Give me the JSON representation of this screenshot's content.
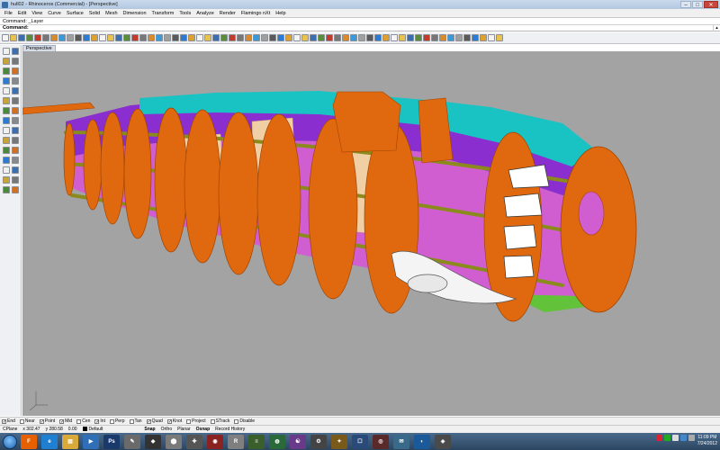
{
  "window": {
    "title": "hull02 - Rhinoceros (Commercial) - [Perspective]",
    "controls": {
      "minimize": "–",
      "maximize": "□",
      "close": "✕"
    }
  },
  "menu": [
    "File",
    "Edit",
    "View",
    "Curve",
    "Surface",
    "Solid",
    "Mesh",
    "Dimension",
    "Transform",
    "Tools",
    "Analyze",
    "Render",
    "Flamingo nXt",
    "Help"
  ],
  "command": {
    "history": "Command: _Layer",
    "prompt_label": "Command:",
    "value": ""
  },
  "viewport": {
    "tab_label": "Perspective",
    "background": "#a3a3a3"
  },
  "colors": {
    "frame_orange": "#e0690f",
    "frame_edge": "#a24400",
    "skin_purple": "#8a2ed0",
    "skin_pink": "#d15ed1",
    "skin_cyan": "#19c3c3",
    "stringer_olive": "#8a8b1c",
    "floor_tan": "#efcfa3",
    "skin_green": "#62c23a"
  },
  "osnaps": [
    {
      "label": "End",
      "checked": true
    },
    {
      "label": "Near",
      "checked": false
    },
    {
      "label": "Point",
      "checked": true
    },
    {
      "label": "Mid",
      "checked": true
    },
    {
      "label": "Cen",
      "checked": false
    },
    {
      "label": "Int",
      "checked": true
    },
    {
      "label": "Perp",
      "checked": false
    },
    {
      "label": "Tan",
      "checked": false
    },
    {
      "label": "Quad",
      "checked": true
    },
    {
      "label": "Knot",
      "checked": true
    },
    {
      "label": "Project",
      "checked": false
    },
    {
      "label": "STrack",
      "checked": false
    },
    {
      "label": "Disable",
      "checked": false
    }
  ],
  "status": {
    "cplane": "CPlane",
    "x": "x 302.47",
    "y": "y 280.58",
    "z": "0.00",
    "layer": "Default",
    "toggles": [
      {
        "label": "Snap",
        "on": true
      },
      {
        "label": "Ortho",
        "on": false
      },
      {
        "label": "Planar",
        "on": false
      },
      {
        "label": "Osnap",
        "on": true
      },
      {
        "label": "Record History",
        "on": false
      }
    ]
  },
  "taskbar": {
    "clock_time": "11:09 PM",
    "clock_date": "7/24/2012",
    "apps": [
      {
        "name": "Firefox",
        "glyph": "F",
        "color": "#e66000"
      },
      {
        "name": "Internet Explorer",
        "glyph": "e",
        "color": "#1f7fd1"
      },
      {
        "name": "Explorer",
        "glyph": "▤",
        "color": "#d9a93a"
      },
      {
        "name": "Media Player",
        "glyph": "▶",
        "color": "#2e6fb8"
      },
      {
        "name": "Photoshop",
        "glyph": "Ps",
        "color": "#1b3a6c"
      },
      {
        "name": "Sketchbook",
        "glyph": "✎",
        "color": "#6a6a6a"
      },
      {
        "name": "Inkscape",
        "glyph": "◆",
        "color": "#333333"
      },
      {
        "name": "App 8",
        "glyph": "⬤",
        "color": "#7a7a7a"
      },
      {
        "name": "App 9",
        "glyph": "✚",
        "color": "#555555"
      },
      {
        "name": "App 10",
        "glyph": "◉",
        "color": "#8a2222"
      },
      {
        "name": "Rhino",
        "glyph": "R",
        "color": "#7f7f7f"
      },
      {
        "name": "App 12",
        "glyph": "≡",
        "color": "#3a5f2a"
      },
      {
        "name": "App 13",
        "glyph": "◍",
        "color": "#2a6a3a"
      },
      {
        "name": "App 14",
        "glyph": "☯",
        "color": "#6a3a8a"
      },
      {
        "name": "App 15",
        "glyph": "⚙",
        "color": "#444444"
      },
      {
        "name": "App 16",
        "glyph": "✦",
        "color": "#7a5a1a"
      },
      {
        "name": "App 17",
        "glyph": "☐",
        "color": "#2a4a7a"
      },
      {
        "name": "App 18",
        "glyph": "◎",
        "color": "#5a2a2a"
      },
      {
        "name": "App 19",
        "glyph": "✉",
        "color": "#3a6a8a"
      },
      {
        "name": "App 20",
        "glyph": "◐",
        "color": "#1a5a9a"
      },
      {
        "name": "App 21",
        "glyph": "◈",
        "color": "#4a4a4a"
      }
    ]
  }
}
